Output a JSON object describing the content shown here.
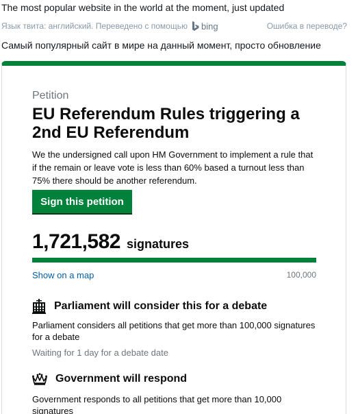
{
  "tweet": {
    "text": "The most popular website in the world at the moment, just updated",
    "translate_label": "Язык твита: английский. Переведено с помощью",
    "translator_name": "bing",
    "translation_error_link": "Ошибка в переводе?",
    "translated_text": "Самый популярный сайт в мире на данный момент, просто обновление"
  },
  "petition": {
    "label": "Petition",
    "title": "EU Referendum Rules triggering a 2nd EU Referendum",
    "description": "We the undersigned call upon HM Government to implement a rule that if the remain or leave vote is less than 60% based a turnout less than 75% there should be another referendum.",
    "sign_button": "Sign this petition",
    "signature_count": "1,721,582",
    "signatures_word": "signatures",
    "progress_fraction": 1.0,
    "show_map_link": "Show on a map",
    "target": "100,000",
    "debate": {
      "icon": "parliament-portcullis-icon",
      "title": "Parliament will consider this for a debate",
      "body": "Parliament considers all petitions that get more than 100,000 signatures for a debate",
      "note": "Waiting for 1 day for a debate date"
    },
    "response": {
      "icon": "crown-icon",
      "title": "Government will respond",
      "body": "Government responds to all petitions that get more than 10,000 signatures"
    }
  },
  "colors": {
    "accent_green": "#00823b",
    "link_blue": "#005ea5",
    "muted_text": "#6f777b",
    "progress_track": "#dee0e2"
  }
}
